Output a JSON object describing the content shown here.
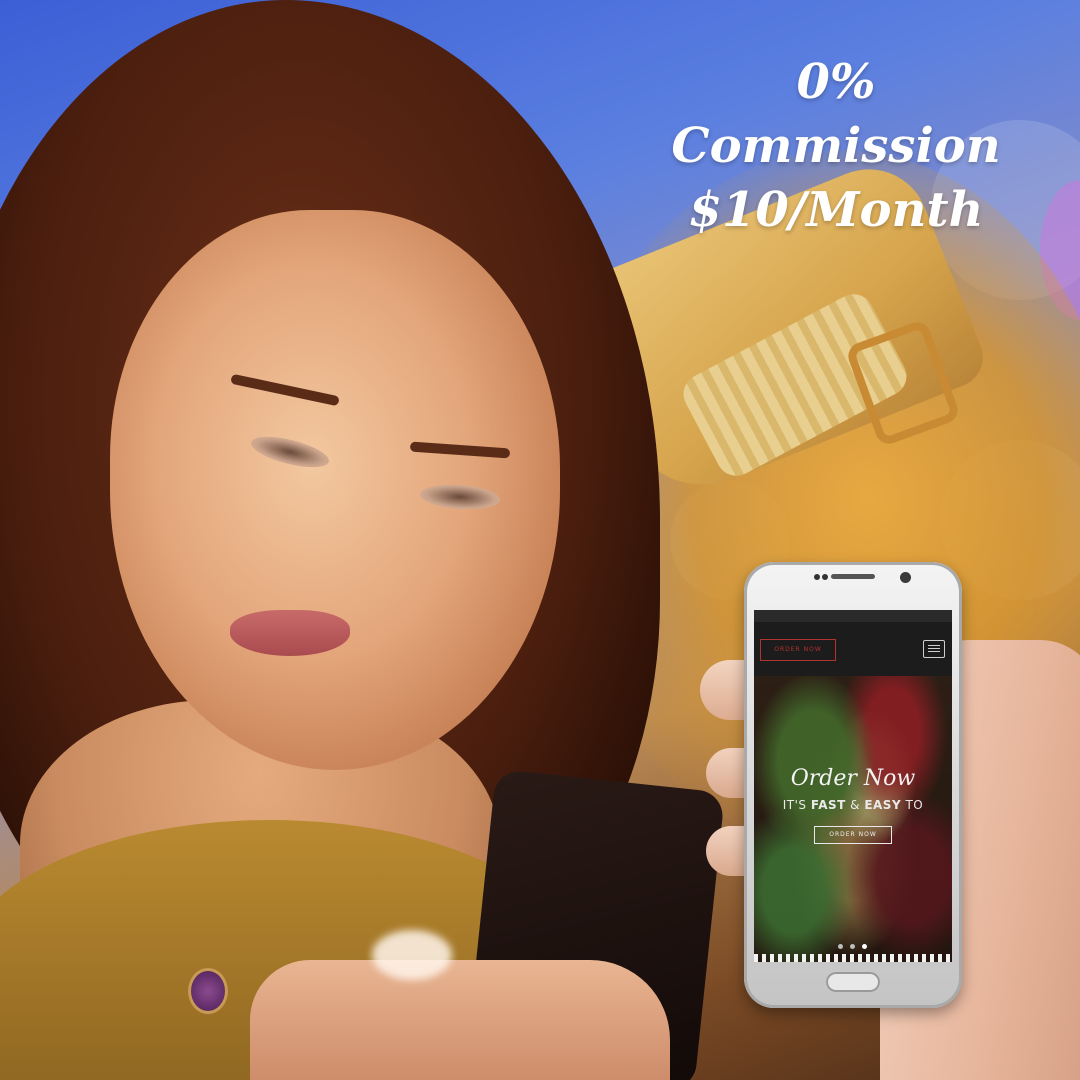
{
  "headline": {
    "line1": "0% Commission",
    "line2": "$10/Month"
  },
  "phone_screen": {
    "nav_order_button": "ORDER NOW",
    "menu_icon": "hamburger-menu-icon",
    "hero_title": "Order Now",
    "hero_subtitle_prefix": "IT'S ",
    "hero_subtitle_fast": "FAST",
    "hero_subtitle_mid": " & ",
    "hero_subtitle_easy": "EASY",
    "hero_subtitle_suffix": " TO",
    "hero_button": "ORDER NOW",
    "carousel_dots": 3,
    "carousel_active_dot": 3
  },
  "colors": {
    "headline_text": "#ffffff",
    "order_button_border": "#b0332f",
    "background_blue": "#3c5fd6",
    "sleeve_mustard": "#d6a44c"
  }
}
